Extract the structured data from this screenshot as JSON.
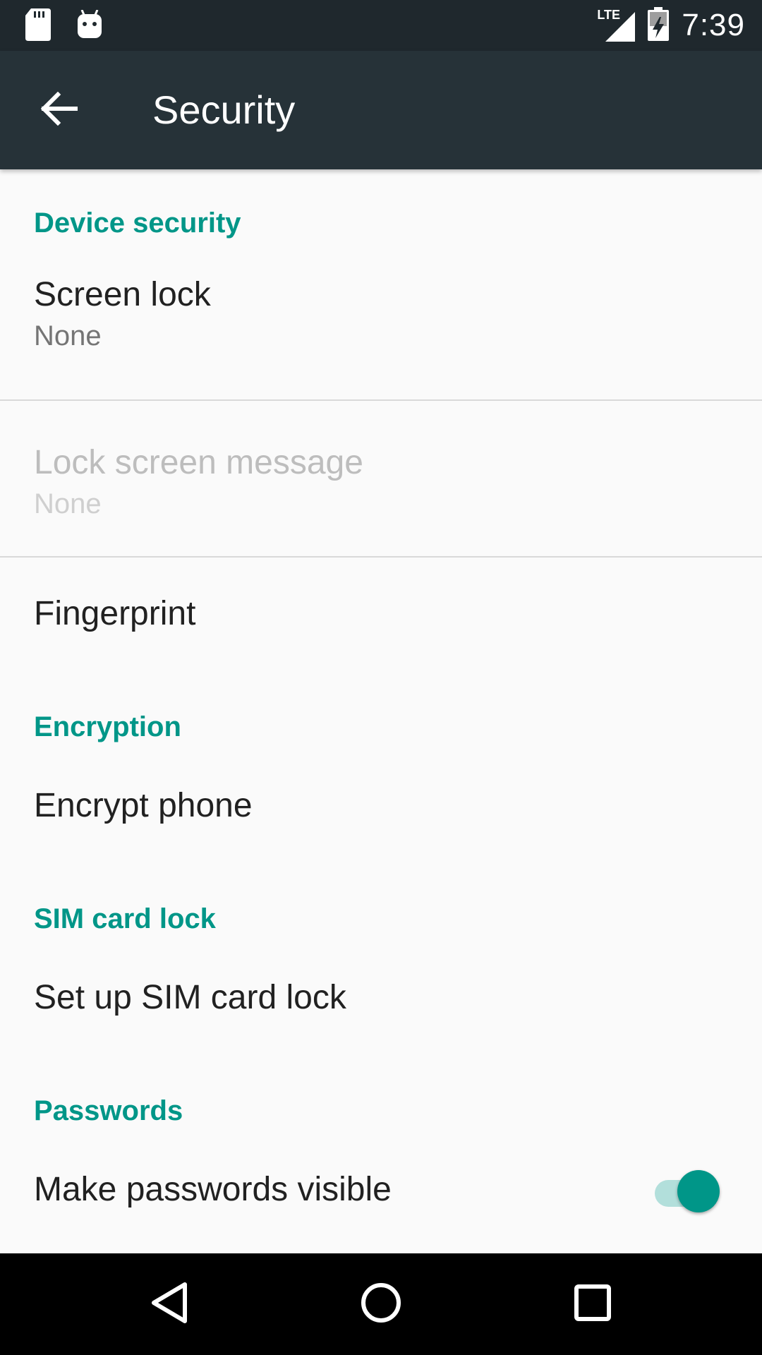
{
  "status_bar": {
    "time": "7:39",
    "network": "LTE",
    "icons": [
      "sd-card-icon",
      "android-icon",
      "signal-icon",
      "battery-charging-icon"
    ]
  },
  "app_bar": {
    "title": "Security",
    "back_icon": "arrow-back-icon"
  },
  "sections": {
    "device_security": "Device security",
    "encryption": "Encryption",
    "sim_card_lock": "SIM card lock",
    "passwords": "Passwords"
  },
  "items": {
    "screen_lock": {
      "title": "Screen lock",
      "summary": "None"
    },
    "lock_screen_message": {
      "title": "Lock screen message",
      "summary": "None",
      "enabled": false
    },
    "fingerprint": {
      "title": "Fingerprint"
    },
    "encrypt_phone": {
      "title": "Encrypt phone"
    },
    "sim_lock": {
      "title": "Set up SIM card lock"
    },
    "passwords_visible": {
      "title": "Make passwords visible",
      "toggle_on": true
    }
  },
  "colors": {
    "accent": "#009688",
    "app_bar": "#263238",
    "status_bar": "#1f282d",
    "background": "#fafafa"
  },
  "nav_bar": {
    "icons": [
      "back-triangle-icon",
      "home-circle-icon",
      "recents-square-icon"
    ]
  }
}
